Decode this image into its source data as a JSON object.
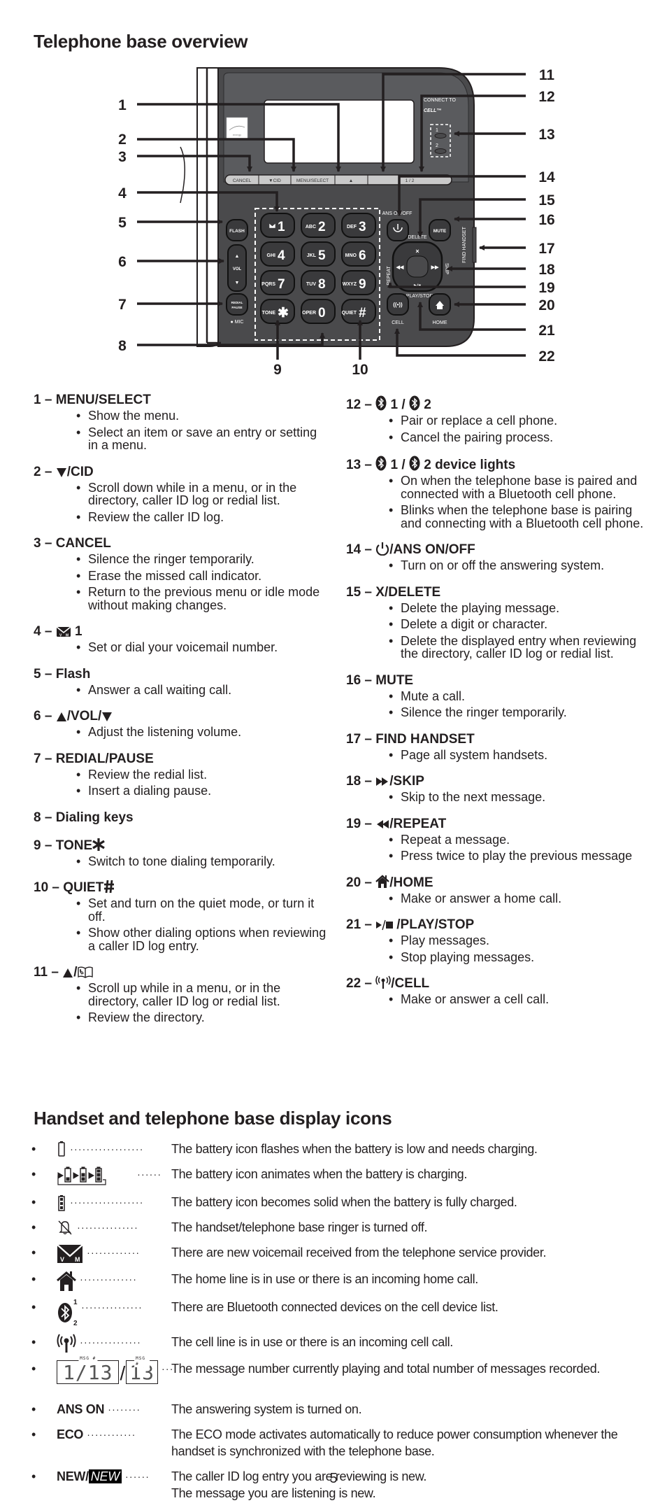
{
  "page": {
    "section1_title": "Telephone base overview",
    "section2_title": "Handset and telephone base display icons",
    "page_number": "5"
  },
  "diagram": {
    "callouts": [
      "1",
      "2",
      "3",
      "4",
      "5",
      "6",
      "7",
      "8",
      "9",
      "10",
      "11",
      "12",
      "13",
      "14",
      "15",
      "16",
      "17",
      "18",
      "19",
      "20",
      "21",
      "22"
    ],
    "soft_keys": [
      "CANCEL",
      "▼CID",
      "MENU/SELECT",
      "▲",
      "1 / 2"
    ],
    "keypad": [
      {
        "letters": "",
        "digit": "1",
        "icon": "voicemail"
      },
      {
        "letters": "ABC",
        "digit": "2"
      },
      {
        "letters": "DEF",
        "digit": "3"
      },
      {
        "letters": "GHI",
        "digit": "4"
      },
      {
        "letters": "JKL",
        "digit": "5"
      },
      {
        "letters": "MNO",
        "digit": "6"
      },
      {
        "letters": "PQRS",
        "digit": "7"
      },
      {
        "letters": "TUV",
        "digit": "8"
      },
      {
        "letters": "WXYZ",
        "digit": "9"
      },
      {
        "letters": "TONE",
        "digit": "✱"
      },
      {
        "letters": "OPER",
        "digit": "0"
      },
      {
        "letters": "QUIET",
        "digit": "#"
      }
    ],
    "labels": {
      "flash": "FLASH",
      "vol": "VOL",
      "redial": "REDIAL",
      "pause": "PAUSE",
      "mic": "● MIC",
      "ans_onoff": "ANS ON/OFF",
      "mute": "MUTE",
      "delete": "DELETE",
      "repeat": "REPEAT",
      "skip": "SKIP",
      "play_stop": "PLAY/STOP",
      "find_handset": "FIND HANDSET",
      "cell": "CELL",
      "home": "HOME",
      "connect_to": "CONNECT TO",
      "cell_logo": "CELL™",
      "bt1": "1",
      "bt2": "2"
    }
  },
  "left_items": [
    {
      "num": "1",
      "title": "MENU/SELECT",
      "bullets": [
        "Show the menu.",
        "Select an item or save an entry or setting in a menu."
      ]
    },
    {
      "num": "2",
      "title": "/CID",
      "icon": "triangle-down",
      "bullets": [
        "Scroll down while in a menu, or in the directory, caller ID log or redial list.",
        "Review the caller ID log."
      ]
    },
    {
      "num": "3",
      "title": "CANCEL",
      "bullets": [
        "Silence the ringer temporarily.",
        "Erase the missed call indicator.",
        "Return to the previous menu or idle mode without making changes."
      ]
    },
    {
      "num": "4",
      "title": " 1",
      "icon": "voicemail",
      "bullets": [
        "Set or dial your voicemail number."
      ]
    },
    {
      "num": "5",
      "title": "Flash",
      "bullets": [
        "Answer a call waiting call."
      ]
    },
    {
      "num": "6",
      "title": "/VOL/",
      "icon": "triangle-up-down",
      "bullets": [
        "Adjust the listening volume."
      ]
    },
    {
      "num": "7",
      "title": "REDIAL/PAUSE",
      "bullets": [
        "Review the redial list.",
        "Insert a dialing pause."
      ]
    },
    {
      "num": "8",
      "title": "Dialing keys",
      "bullets": []
    },
    {
      "num": "9",
      "title": "TONE",
      "icon": "star",
      "bullets": [
        "Switch to tone dialing temporarily."
      ]
    },
    {
      "num": "10",
      "title": "QUIET",
      "icon": "hash",
      "bullets": [
        "Set and turn on the quiet mode, or turn it off.",
        "Show other dialing options when reviewing a caller ID log entry."
      ]
    },
    {
      "num": "11",
      "title": "/",
      "icon": "triangle-up-directory",
      "bullets": [
        "Scroll up while in a menu, or in the directory, caller ID log or redial list.",
        "Review the directory."
      ]
    }
  ],
  "right_items": [
    {
      "num": "12",
      "title": "1 / 2",
      "icon": "bluetooth",
      "bullets": [
        "Pair or replace a cell phone.",
        "Cancel the pairing process."
      ]
    },
    {
      "num": "13",
      "title": "1 / 2 device lights",
      "icon": "bluetooth",
      "bullets": [
        "On when the telephone base is paired and connected with a Bluetooth cell phone.",
        "Blinks when the telephone base is pairing and connecting with a Bluetooth cell phone."
      ]
    },
    {
      "num": "14",
      "title": "/ANS ON/OFF",
      "icon": "power",
      "bullets": [
        "Turn on or off the answering system."
      ]
    },
    {
      "num": "15",
      "title": "X/DELETE",
      "bullets": [
        "Delete the playing message.",
        "Delete a digit or character.",
        "Delete the displayed entry when reviewing the directory, caller ID log or redial list."
      ]
    },
    {
      "num": "16",
      "title": "MUTE",
      "bullets": [
        "Mute a call.",
        "Silence the ringer temporarily."
      ]
    },
    {
      "num": "17",
      "title": "FIND HANDSET",
      "bullets": [
        "Page all system handsets."
      ]
    },
    {
      "num": "18",
      "title": "/SKIP",
      "icon": "skip",
      "bullets": [
        "Skip to the next message."
      ]
    },
    {
      "num": "19",
      "title": "/REPEAT",
      "icon": "repeat",
      "bullets": [
        "Repeat a message.",
        "Press twice to play the previous message"
      ]
    },
    {
      "num": "20",
      "title": "/HOME",
      "icon": "home",
      "bullets": [
        "Make or answer a home call."
      ]
    },
    {
      "num": "21",
      "title": "/PLAY/STOP",
      "icon": "play-stop",
      "bullets": [
        "Play messages.",
        "Stop playing messages."
      ]
    },
    {
      "num": "22",
      "title": "/CELL",
      "icon": "cell",
      "bullets": [
        "Make or answer a cell call."
      ]
    }
  ],
  "display_icons": [
    {
      "icon": "battery-low",
      "desc": "The battery icon flashes when the battery is low and needs charging."
    },
    {
      "icon": "battery-charging",
      "desc": "The battery icon animates when the battery is charging."
    },
    {
      "icon": "battery-full",
      "desc": "The battery icon becomes solid when the battery is fully charged."
    },
    {
      "icon": "ringer-off",
      "desc": "The handset/telephone base ringer is turned off."
    },
    {
      "icon": "voicemail",
      "desc": "There are new voicemail received from the telephone service provider."
    },
    {
      "icon": "home",
      "desc": "The home line is in use or there is an incoming home call."
    },
    {
      "icon": "bluetooth-devices",
      "desc": "There are Bluetooth connected devices on the cell device list."
    },
    {
      "icon": "cell",
      "desc": "The cell line is in use or there is an incoming cell call."
    },
    {
      "icon": "message-counter",
      "msg_label": "MSG #",
      "current": "1/13",
      "total": "13",
      "desc": "The message number currently playing and total number of messages recorded."
    },
    {
      "icon": "text",
      "label": "ANS ON",
      "desc": "The answering system is turned on."
    },
    {
      "icon": "text",
      "label": "ECO",
      "desc": "The ECO mode activates automatically to reduce power consumption whenever the handset is synchronized with the telephone base."
    },
    {
      "icon": "text-new",
      "label": "NEW/",
      "label_inverse": "NEW",
      "desc": "The caller ID log entry you are reviewing is new.\nThe message you are listening is new."
    }
  ]
}
